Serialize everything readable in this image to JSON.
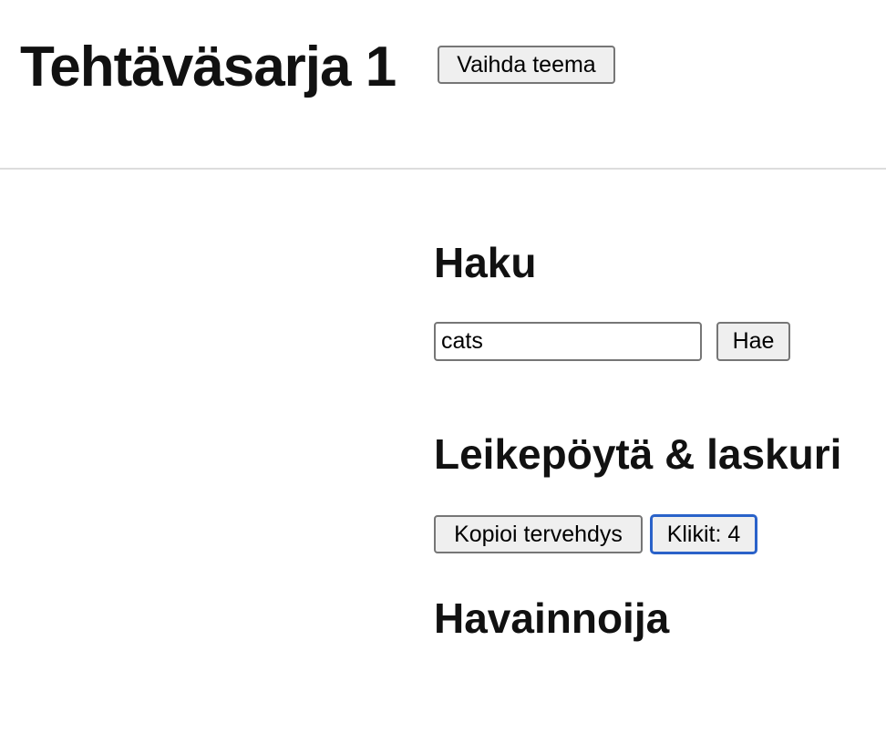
{
  "header": {
    "title": "Tehtäväsarja 1",
    "theme_button_label": "Vaihda teema"
  },
  "search": {
    "section_title": "Haku",
    "input_value": "cats",
    "button_label": "Hae"
  },
  "clipboard": {
    "section_title": "Leikepöytä & laskuri",
    "copy_button_label": "Kopioi tervehdys",
    "counter_button_label": "Klikit: 4"
  },
  "observer": {
    "section_title": "Havainnoija"
  },
  "colors": {
    "focus_ring": "#2a62c9",
    "divider": "#dddddd",
    "button_background": "#efefef"
  }
}
